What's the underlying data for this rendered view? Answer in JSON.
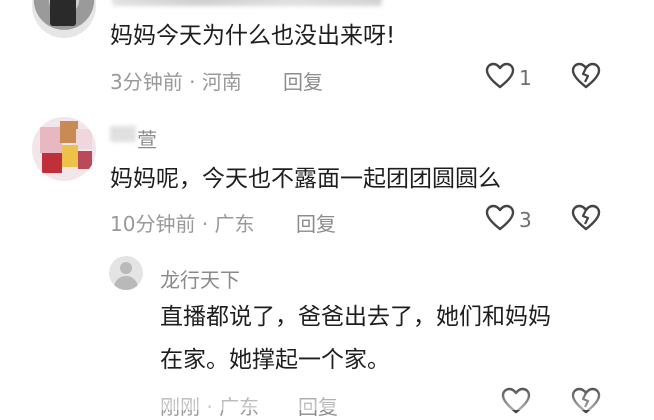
{
  "comments": [
    {
      "text": "妈妈今天为什么也没出来呀!",
      "time": "3分钟前",
      "location": "河南",
      "reply_label": "回复",
      "like_count": "1"
    },
    {
      "username": "萱",
      "text": "妈妈呢，今天也不露面一起团团圆圆么",
      "time": "10分钟前",
      "location": "广东",
      "reply_label": "回复",
      "like_count": "3",
      "replies": [
        {
          "username": "龙行天下",
          "text_line1": "直播都说了，爸爸出去了，她们和妈妈",
          "text_line2": "在家。她撑起一个家。",
          "time": "刚刚",
          "location": "广东",
          "reply_label": "回复"
        }
      ]
    }
  ],
  "separator": "·",
  "icons": {
    "like": "heart-outline-icon",
    "dislike": "broken-heart-icon"
  },
  "colors": {
    "text": "#1e1e1e",
    "meta": "#999999",
    "icon": "#444444"
  }
}
